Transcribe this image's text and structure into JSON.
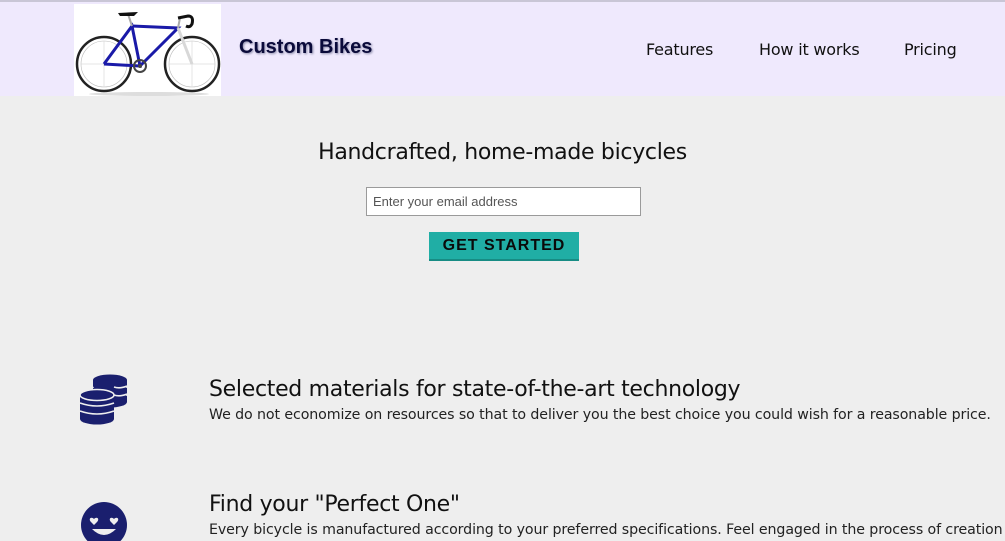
{
  "header": {
    "brand": "Custom Bikes",
    "logo_icon": "bicycle-icon",
    "nav": [
      {
        "label": "Features"
      },
      {
        "label": "How it works"
      },
      {
        "label": "Pricing"
      }
    ]
  },
  "hero": {
    "title": "Handcrafted, home-made bicycles",
    "email_placeholder": "Enter your email address",
    "cta_label": "GET STARTED"
  },
  "features": [
    {
      "icon": "coins-icon",
      "title": "Selected materials for state-of-the-art technology",
      "text": "We do not economize on resources so that to deliver you the best choice you could wish for a reasonable price."
    },
    {
      "icon": "heart-eyes-smiley-icon",
      "title": "Find your \"Perfect One\"",
      "text": "Every bicycle is manufactured according to your preferred specifications. Feel engaged in the process of creation"
    }
  ],
  "colors": {
    "header_bg": "#efe9fd",
    "page_bg": "#eeeeee",
    "cta_bg": "#20aea5",
    "icon_navy": "#1a1f6e"
  }
}
